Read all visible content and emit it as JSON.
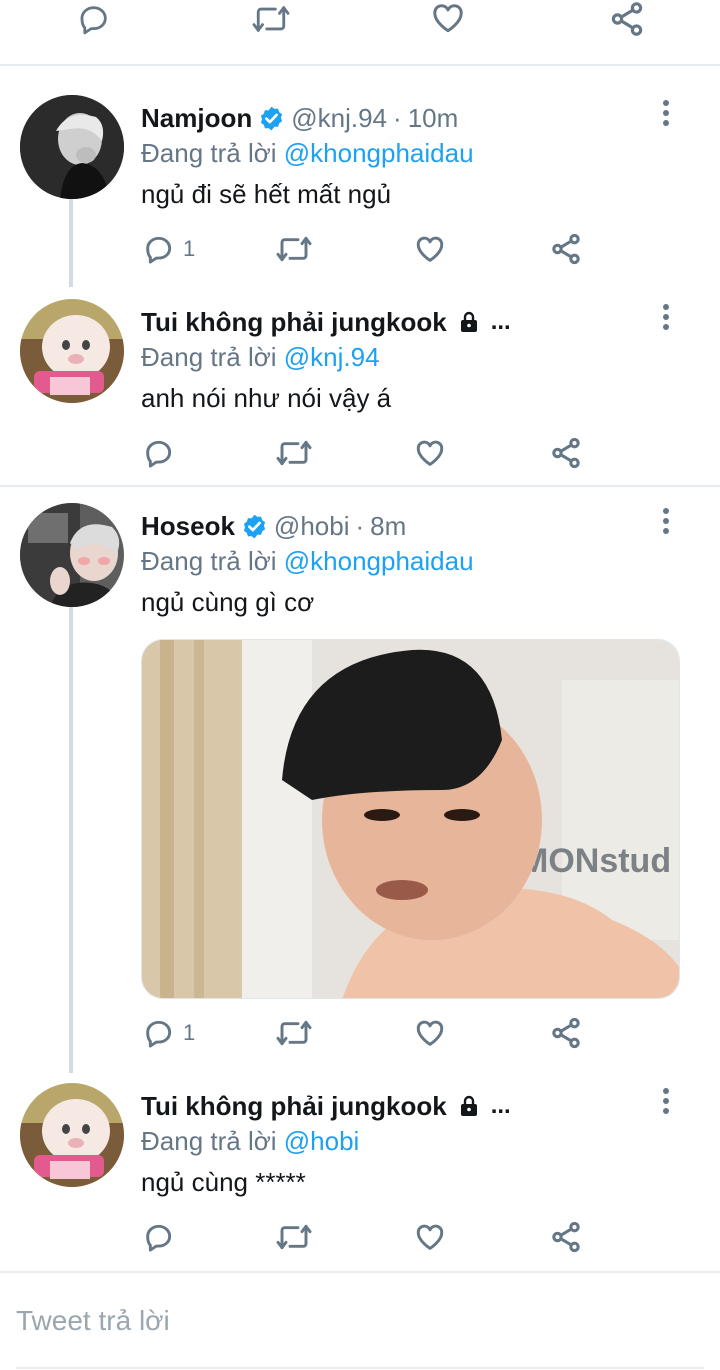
{
  "colors": {
    "accent": "#1da1f2",
    "muted": "#657786",
    "divider": "#e6ecf0"
  },
  "top_actions": {
    "icons": [
      "reply-icon",
      "retweet-icon",
      "like-icon",
      "share-icon"
    ]
  },
  "tweets": [
    {
      "name": "Namjoon",
      "verified": true,
      "handle": "@knj.94",
      "dot": "·",
      "time": "10m",
      "replying_prefix": "Đang trả lời ",
      "replying_to": "@khongphaidau",
      "text": "ngủ đi sẽ hết mất ngủ",
      "reply_count": "1"
    },
    {
      "name": "Tui không phải jungkook",
      "protected": true,
      "ellipsis": "...",
      "replying_prefix": "Đang trả lời ",
      "replying_to": "@knj.94",
      "text": "anh nói như nói vậy á"
    },
    {
      "name": "Hoseok",
      "verified": true,
      "handle": "@hobi",
      "dot": "·",
      "time": "8m",
      "replying_prefix": "Đang trả lời ",
      "replying_to": "@khongphaidau",
      "text": "ngủ cùng gì cơ",
      "media_text": "MONstud",
      "reply_count": "1"
    },
    {
      "name": "Tui không phải jungkook",
      "protected": true,
      "ellipsis": "...",
      "replying_prefix": "Đang trả lời ",
      "replying_to": "@hobi",
      "text": "ngủ cùng *****"
    }
  ],
  "compose": {
    "placeholder": "Tweet trả lời"
  }
}
